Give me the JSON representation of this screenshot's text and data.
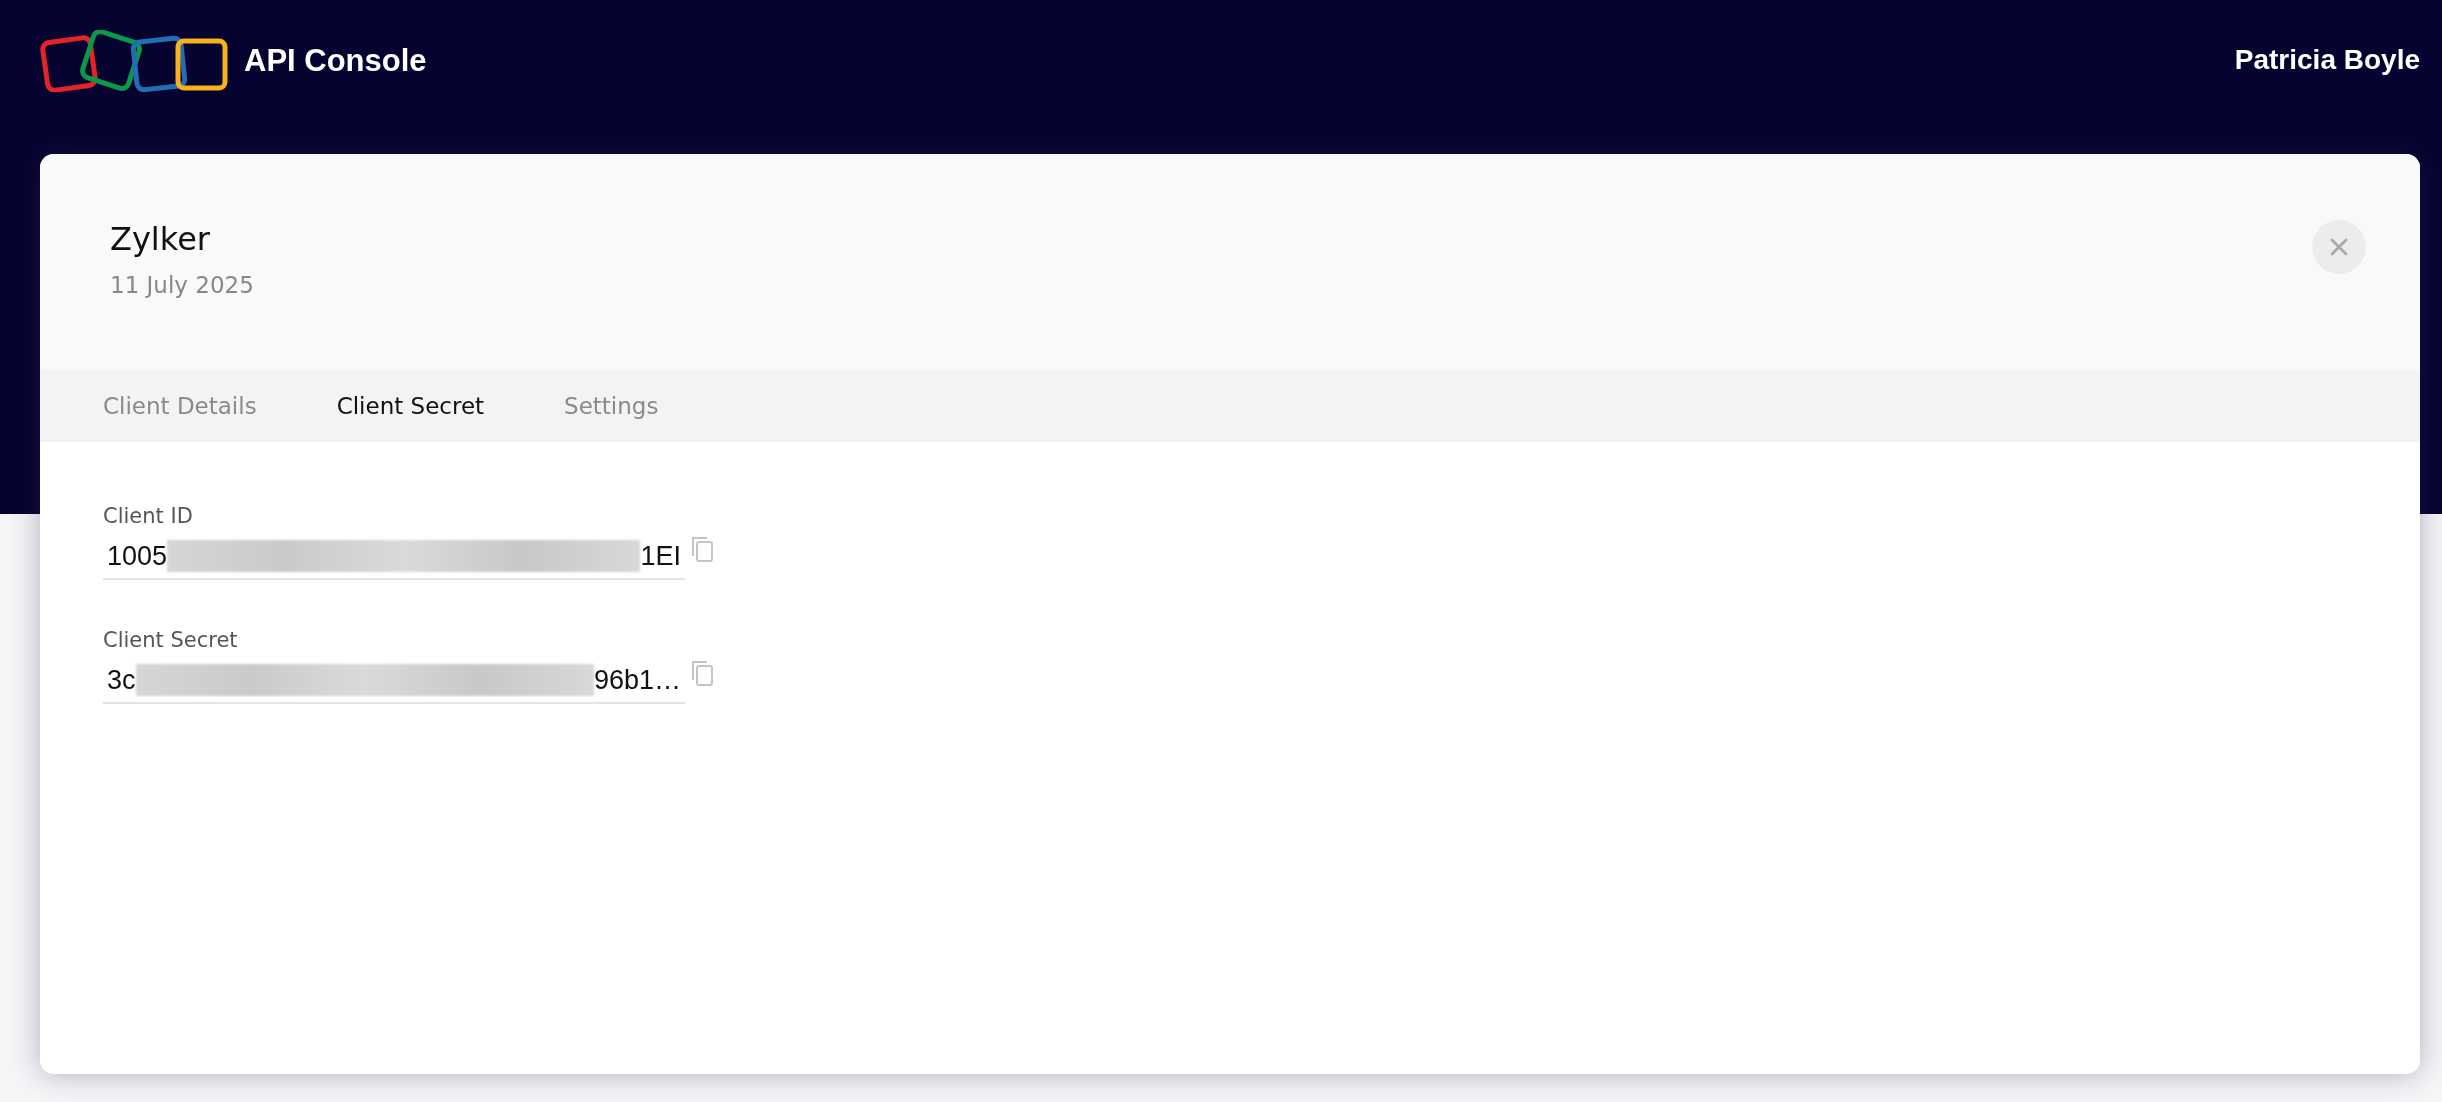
{
  "header": {
    "app_title": "API Console",
    "user_name": "Patricia Boyle"
  },
  "client": {
    "name": "Zylker",
    "date": "11 July 2025"
  },
  "tabs": [
    {
      "label": "Client Details",
      "selected": false
    },
    {
      "label": "Client Secret",
      "selected": true
    },
    {
      "label": "Settings",
      "selected": false
    }
  ],
  "fields": [
    {
      "label": "Client ID",
      "value_start": "1005",
      "value_end": "1EI",
      "redacted": true
    },
    {
      "label": "Client Secret",
      "value_start": "3c",
      "value_end": "96b1…",
      "redacted": true
    }
  ]
}
